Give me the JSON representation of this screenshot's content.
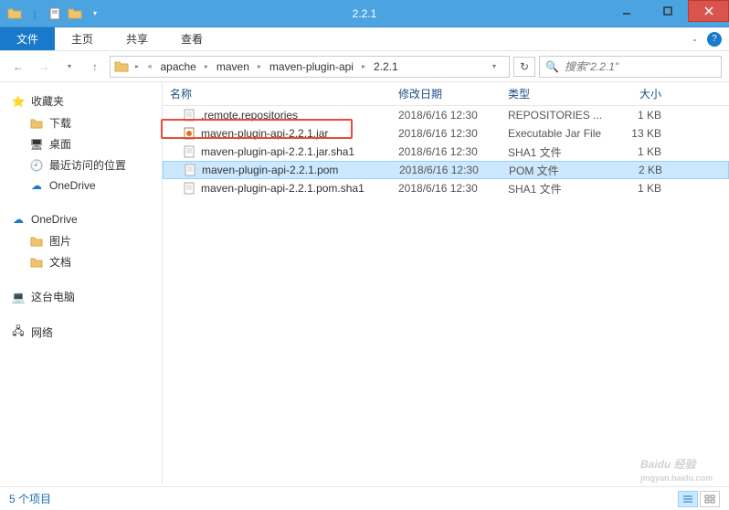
{
  "window": {
    "title": "2.2.1"
  },
  "menubar": {
    "file": "文件",
    "home": "主页",
    "share": "共享",
    "view": "查看"
  },
  "breadcrumb": {
    "items": [
      "apache",
      "maven",
      "maven-plugin-api",
      "2.2.1"
    ]
  },
  "search": {
    "placeholder": "搜索\"2.2.1\""
  },
  "sidebar": {
    "favorites": {
      "label": "收藏夹",
      "items": [
        {
          "icon": "download-icon",
          "label": "下载"
        },
        {
          "icon": "desktop-icon",
          "label": "桌面"
        },
        {
          "icon": "recent-icon",
          "label": "最近访问的位置"
        },
        {
          "icon": "onedrive-icon",
          "label": "OneDrive"
        }
      ]
    },
    "onedrive": {
      "label": "OneDrive",
      "items": [
        {
          "icon": "folder-icon",
          "label": "图片"
        },
        {
          "icon": "folder-icon",
          "label": "文档"
        }
      ]
    },
    "thispc": {
      "label": "这台电脑"
    },
    "network": {
      "label": "网络"
    }
  },
  "columns": {
    "name": "名称",
    "date": "修改日期",
    "type": "类型",
    "size": "大小"
  },
  "files": [
    {
      "icon": "file",
      "name": ".remote.repositories",
      "date": "2018/6/16 12:30",
      "type": "REPOSITORIES ...",
      "size": "1 KB",
      "selected": false,
      "highlight": false
    },
    {
      "icon": "jar",
      "name": "maven-plugin-api-2.2.1.jar",
      "date": "2018/6/16 12:30",
      "type": "Executable Jar File",
      "size": "13 KB",
      "selected": false,
      "highlight": true
    },
    {
      "icon": "file",
      "name": "maven-plugin-api-2.2.1.jar.sha1",
      "date": "2018/6/16 12:30",
      "type": "SHA1 文件",
      "size": "1 KB",
      "selected": false,
      "highlight": false
    },
    {
      "icon": "file",
      "name": "maven-plugin-api-2.2.1.pom",
      "date": "2018/6/16 12:30",
      "type": "POM 文件",
      "size": "2 KB",
      "selected": true,
      "highlight": false
    },
    {
      "icon": "file",
      "name": "maven-plugin-api-2.2.1.pom.sha1",
      "date": "2018/6/16 12:30",
      "type": "SHA1 文件",
      "size": "1 KB",
      "selected": false,
      "highlight": false
    }
  ],
  "statusbar": {
    "count": "5 个项目"
  },
  "watermark": {
    "brand": "Baidu 经验",
    "url": "jingyan.baidu.com"
  }
}
